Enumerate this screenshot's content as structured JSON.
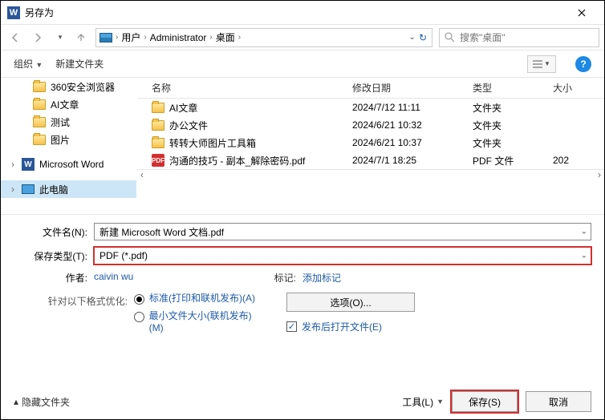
{
  "title": "另存为",
  "breadcrumbs": [
    "用户",
    "Administrator",
    "桌面"
  ],
  "search_placeholder": "搜索\"桌面\"",
  "toolbar": {
    "organize": "组织",
    "new_folder": "新建文件夹"
  },
  "tree": {
    "items": [
      "360安全浏览器",
      "AI文章",
      "测试",
      "图片"
    ],
    "word": "Microsoft Word",
    "pc": "此电脑"
  },
  "columns": {
    "name": "名称",
    "date": "修改日期",
    "type": "类型",
    "size": "大小"
  },
  "files": [
    {
      "name": "AI文章",
      "date": "2024/7/12 11:11",
      "type": "文件夹",
      "size": "",
      "kind": "folder"
    },
    {
      "name": "办公文件",
      "date": "2024/6/21 10:32",
      "type": "文件夹",
      "size": "",
      "kind": "folder"
    },
    {
      "name": "转转大师图片工具箱",
      "date": "2024/6/21 10:37",
      "type": "文件夹",
      "size": "",
      "kind": "folder"
    },
    {
      "name": "沟通的技巧 - 副本_解除密码.pdf",
      "date": "2024/7/1 18:25",
      "type": "PDF 文件",
      "size": "202",
      "kind": "pdf"
    }
  ],
  "form": {
    "filename_label": "文件名(N):",
    "filename_value": "新建 Microsoft Word 文档.pdf",
    "type_label": "保存类型(T):",
    "type_value": "PDF (*.pdf)"
  },
  "meta": {
    "author_label": "作者:",
    "author_value": "caivin wu",
    "tags_label": "标记:",
    "tags_value": "添加标记"
  },
  "optimize": {
    "label": "针对以下格式优化:",
    "opt1": "标准(打印和联机发布)(A)",
    "opt2": "最小文件大小(联机发布)(M)"
  },
  "options_btn": "选项(O)...",
  "open_after": "发布后打开文件(E)",
  "footer": {
    "hide": "隐藏文件夹",
    "tools": "工具(L)",
    "save": "保存(S)",
    "cancel": "取消"
  }
}
